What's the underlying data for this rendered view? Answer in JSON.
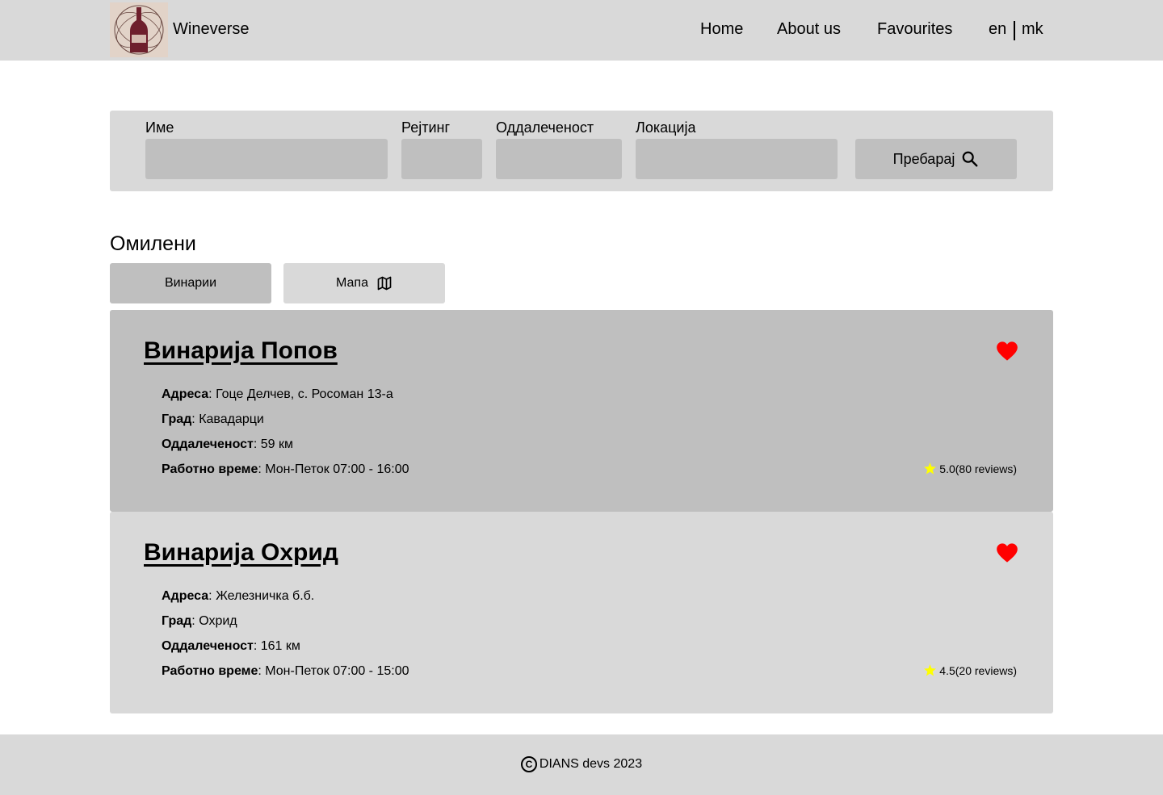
{
  "header": {
    "brand": "Wineverse",
    "nav": [
      "Home",
      "About us",
      "Favourites"
    ],
    "lang": [
      "en",
      "mk"
    ]
  },
  "search": {
    "labels": {
      "name": "Име",
      "rating": "Рејтинг",
      "distance": "Оддалеченост",
      "location": "Локација"
    },
    "values": {
      "name": "",
      "rating": "",
      "distance": "",
      "location": ""
    },
    "button": "Пребарај"
  },
  "section_title": "Омилени",
  "tabs": {
    "wineries": "Винарии",
    "map": "Мапа"
  },
  "field_labels": {
    "address": "Адреса",
    "city": "Град",
    "distance": "Оддалеченост",
    "hours": "Работно време"
  },
  "wineries": [
    {
      "name": "Винарија Попов",
      "address": ": Гоце Делчев, с. Росоман 13-а",
      "city": ": Кавадарци",
      "distance": ": 59 км",
      "hours": ": Мон-Петок 07:00 - 16:00",
      "rating": "5.0(80 reviews)",
      "bg": "#bfbfbf"
    },
    {
      "name": "Винарија Охрид",
      "address": ": Железничка б.б.",
      "city": ": Охрид",
      "distance": ": 161 км",
      "hours": ": Мон-Петок 07:00 - 15:00",
      "rating": "4.5(20 reviews)",
      "bg": "#d9d9d9"
    }
  ],
  "footer": {
    "text": "DIANS devs 2023"
  },
  "colors": {
    "heart": "#ff0000",
    "star": "#ffff00",
    "panel": "#d9d9d9",
    "input": "#bfbfbf"
  }
}
